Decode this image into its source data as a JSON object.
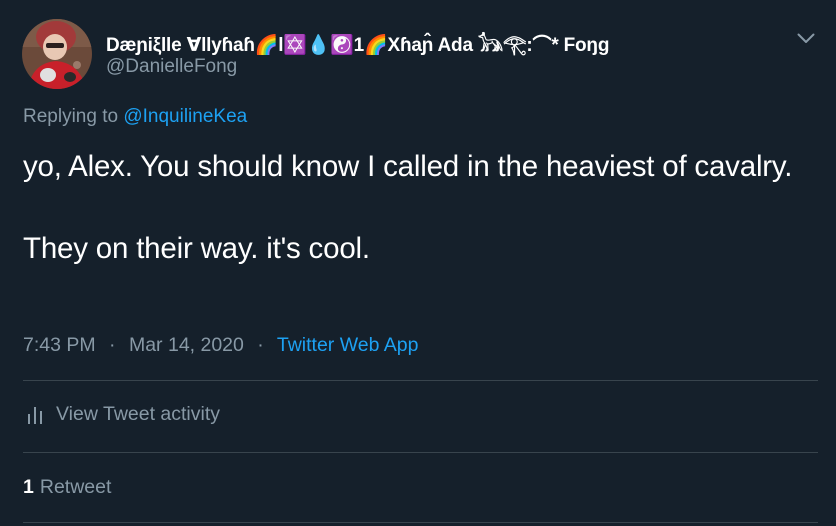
{
  "author": {
    "display_name": "Dæɲiξlle ∀llyɦaɦ🌈l✡️💧☯️1🌈Xɦaɲ̂ Ada 𓃥𓂀:⌒* Foŋg",
    "handle": "@DanielleFong"
  },
  "reply": {
    "prefix": "Replying to",
    "to_handle": "@InquilineKea"
  },
  "tweet": {
    "line1": "yo, Alex. You should know I called in the heaviest of cavalry.",
    "line2": "They on their way. it's cool.",
    "time": "7:43 PM",
    "separator": "·",
    "date": "Mar 14, 2020",
    "source": "Twitter Web App"
  },
  "activity": {
    "label": "View Tweet activity",
    "icon": "bar-chart-icon"
  },
  "stats": {
    "retweet_count": "1",
    "retweet_label": "Retweet"
  },
  "colors": {
    "background": "#15202b",
    "accent": "#1da1f2",
    "secondary_text": "#8899a6",
    "divider": "#38444d"
  }
}
